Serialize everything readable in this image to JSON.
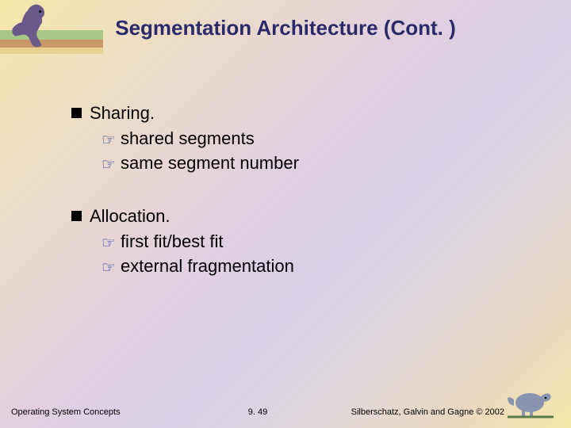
{
  "title": "Segmentation Architecture (Cont. )",
  "bullets": [
    {
      "text": "Sharing.",
      "subs": [
        "shared segments",
        "same segment number"
      ]
    },
    {
      "text": "Allocation.",
      "subs": [
        "first fit/best fit",
        "external fragmentation"
      ]
    }
  ],
  "footer": {
    "left": "Operating System Concepts",
    "center": "9. 49",
    "right": "Silberschatz, Galvin and Gagne © 2002"
  },
  "icons": {
    "pointing_hand": "☞"
  }
}
